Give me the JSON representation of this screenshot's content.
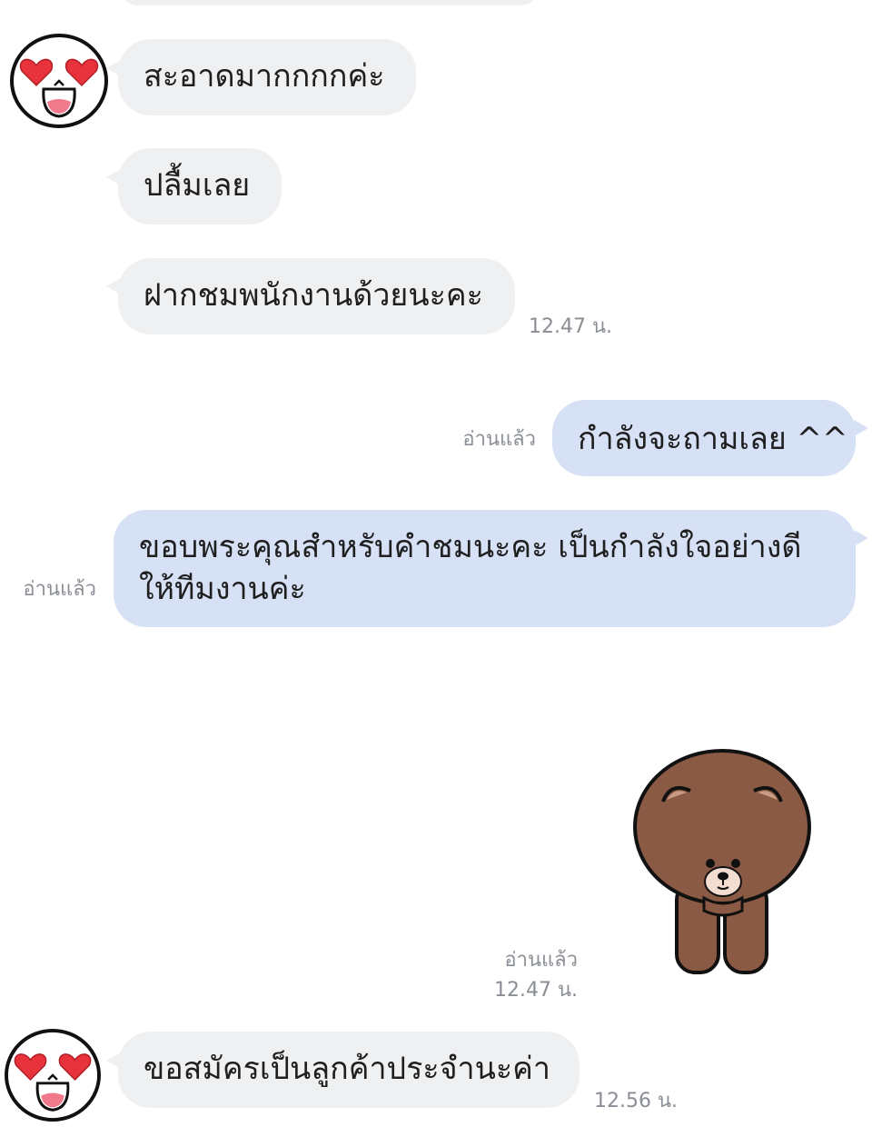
{
  "chat": {
    "messages": [
      {
        "id": "m1",
        "side": "in",
        "text": "สะอาดมากกกกค่ะ"
      },
      {
        "id": "m2",
        "side": "in",
        "text": "ปลื้มเลย"
      },
      {
        "id": "m3",
        "side": "in",
        "text": "ฝากชมพนักงานด้วยนะคะ",
        "time": "12.47 น."
      },
      {
        "id": "m4",
        "side": "out",
        "text": "กำลังจะถามเลย ^^",
        "read": "อ่านแล้ว"
      },
      {
        "id": "m5",
        "side": "out",
        "lines": [
          "ขอบพระคุณสำหรับคำชมนะคะ เป็นกำลังใจอย่างดี",
          "ให้ทีมงานค่ะ"
        ],
        "read": "อ่านแล้ว"
      },
      {
        "id": "m6",
        "side": "out",
        "sticker": "brown-bear-bow-icon",
        "read": "อ่านแล้ว",
        "time": "12.47 น."
      },
      {
        "id": "m7",
        "side": "in",
        "text": "ขอสมัครเป็นลูกค้าประจำนะค่า",
        "time": "12.56 น."
      }
    ],
    "avatar_icon": "heart-eyes-face-icon"
  },
  "colors": {
    "incoming_bubble": "#eff0f2",
    "outgoing_bubble": "#d6e1f5",
    "meta_text": "#8a8e95",
    "bear_body": "#8b5a44",
    "heart": "#e8323c"
  }
}
